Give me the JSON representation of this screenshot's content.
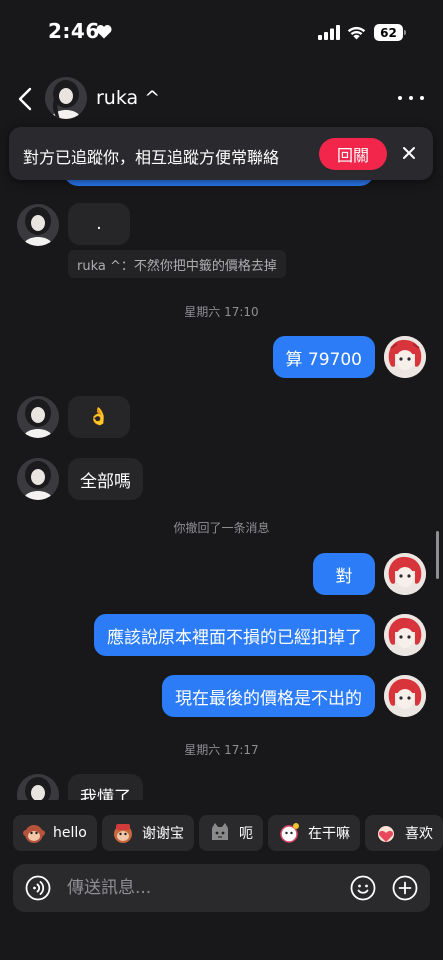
{
  "status_bar": {
    "time": "2:46",
    "battery": "62"
  },
  "header": {
    "contact_name": "ruka ^"
  },
  "notice": {
    "text": "對方已追蹤你，相互追蹤方便常聯絡",
    "follow_back_label": "回關"
  },
  "messages": {
    "m1_text": ".",
    "m1_quote": "ruka ^：不然你把中籤的價格去掉",
    "sep1": "星期六 17:10",
    "m2_text": "算 79700",
    "m3_text": "👌",
    "m4_text": "全部嗎",
    "recall_notice": "你撤回了一条消息",
    "m5_text": "對",
    "m6_text": "應該說原本裡面不損的已經扣掉了",
    "m7_text": "現在最後的價格是不出的",
    "sep2": "星期六 17:17",
    "m8_text": "我懂了"
  },
  "quick_replies": [
    "hello",
    "谢谢宝",
    "呃",
    "在干嘛",
    "喜欢"
  ],
  "input": {
    "placeholder": "傳送訊息..."
  },
  "colors": {
    "background": "#18181b",
    "outgoing_bubble": "#2b7cf6",
    "incoming_bubble": "#262629",
    "follow_button": "#f2264b"
  }
}
